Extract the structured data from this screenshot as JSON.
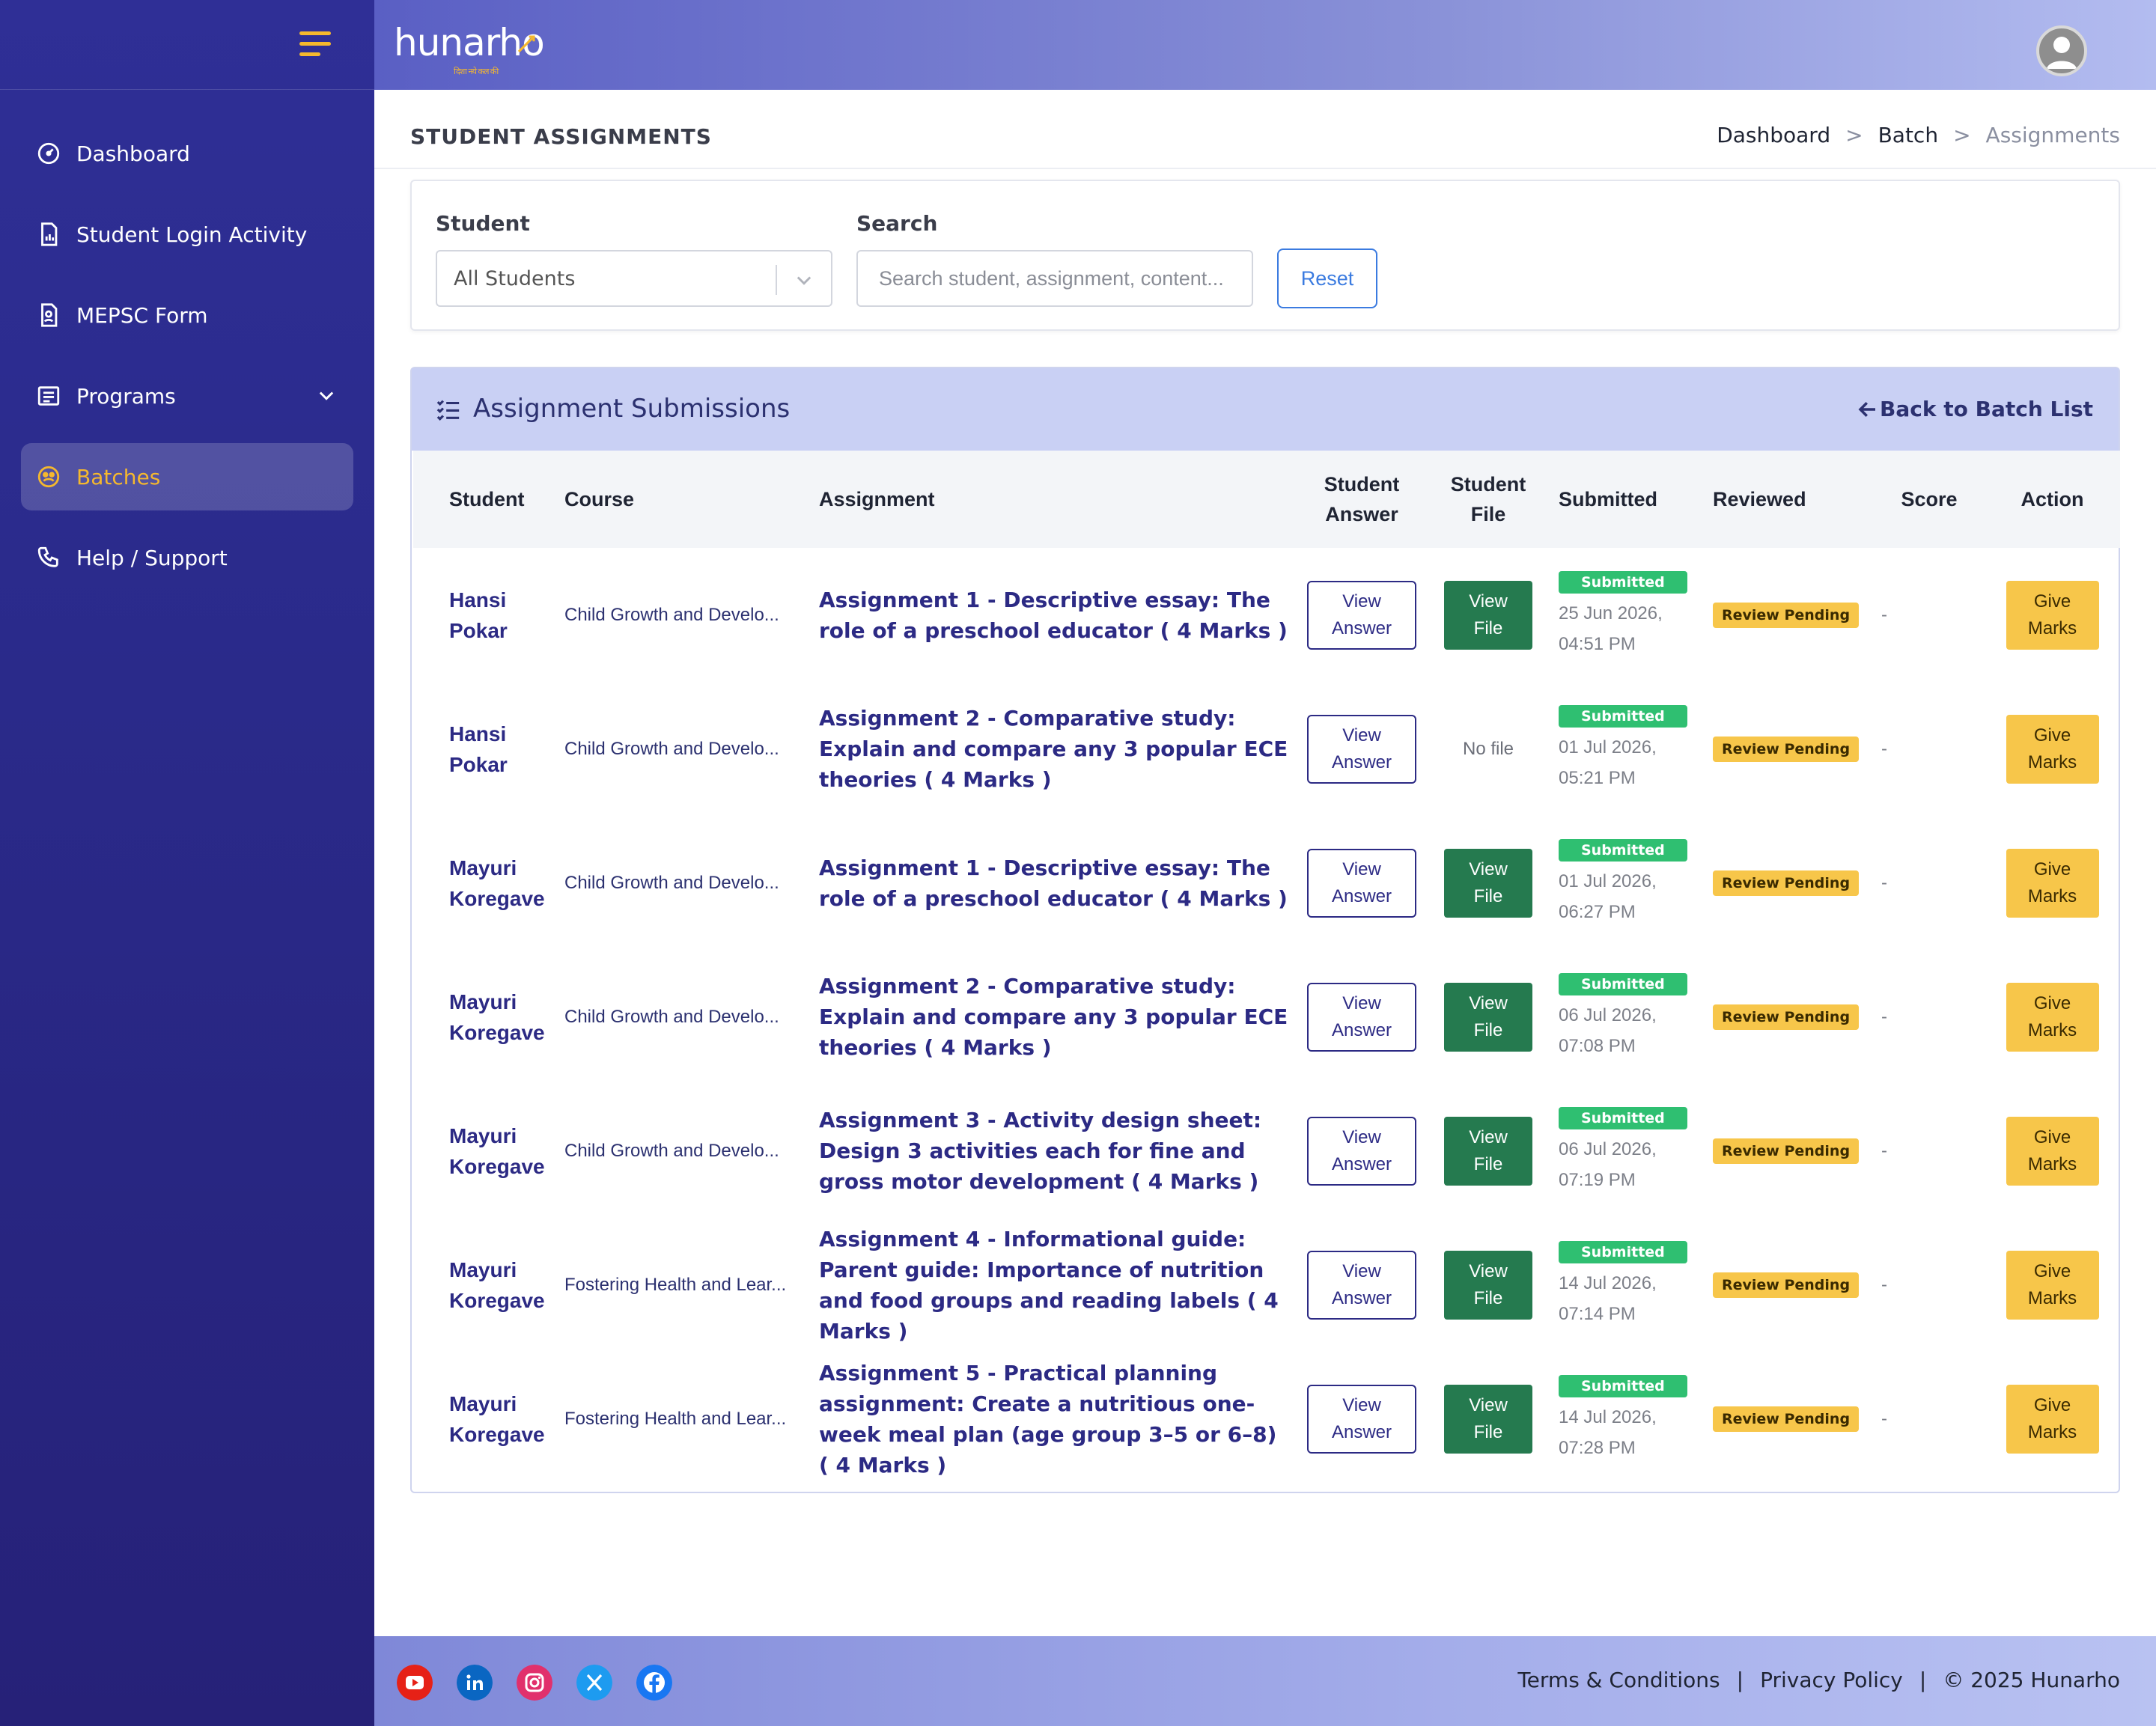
{
  "app": {
    "logo_text": "hunarho",
    "logo_tagline": "दिशा नये कल की"
  },
  "sidebar": {
    "items": [
      {
        "label": "Dashboard",
        "icon": "dashboard-gauge-icon"
      },
      {
        "label": "Student Login Activity",
        "icon": "chart-document-icon"
      },
      {
        "label": "MEPSC Form",
        "icon": "form-document-icon"
      },
      {
        "label": "Programs",
        "icon": "list-icon"
      },
      {
        "label": "Batches",
        "icon": "batches-icon",
        "active": true
      },
      {
        "label": "Help / Support",
        "icon": "phone-icon"
      }
    ]
  },
  "header": {
    "page_title": "STUDENT ASSIGNMENTS",
    "breadcrumb": {
      "item1": "Dashboard",
      "sep": ">",
      "item2": "Batch",
      "current": "Assignments"
    }
  },
  "filters": {
    "student_label": "Student",
    "student_value": "All Students",
    "search_label": "Search",
    "search_placeholder": "Search student, assignment, content...",
    "reset_label": "Reset"
  },
  "submissions": {
    "title": "Assignment Submissions",
    "back_label": "Back to Batch List",
    "columns": {
      "student": "Student",
      "course": "Course",
      "assignment": "Assignment",
      "student_answer_1": "Student",
      "student_answer_2": "Answer",
      "student_file_1": "Student",
      "student_file_2": "File",
      "submitted": "Submitted",
      "reviewed": "Reviewed",
      "score": "Score",
      "action": "Action"
    },
    "view_answer_1": "View",
    "view_answer_2": "Answer",
    "view_file_1": "View",
    "view_file_2": "File",
    "no_file": "No file",
    "submitted_badge": "Submitted",
    "review_badge": "Review Pending",
    "give_marks_1": "Give",
    "give_marks_2": "Marks",
    "rows": [
      {
        "student_first": "Hansi",
        "student_last": "Pokar",
        "course": "Child Growth and Develo...",
        "assignment": "Assignment 1 - Descriptive essay: The role of a preschool educator ( 4 Marks )",
        "has_file": true,
        "date": "25 Jun 2026,",
        "time": "04:51 PM",
        "score": "-"
      },
      {
        "student_first": "Hansi",
        "student_last": "Pokar",
        "course": "Child Growth and Develo...",
        "assignment": "Assignment 2 - Comparative study: Explain and compare any 3 popular ECE theories ( 4 Marks )",
        "has_file": false,
        "date": "01 Jul 2026,",
        "time": "05:21 PM",
        "score": "-"
      },
      {
        "student_first": "Mayuri",
        "student_last": "Koregave",
        "course": "Child Growth and Develo...",
        "assignment": "Assignment 1 - Descriptive essay: The role of a preschool educator ( 4 Marks )",
        "has_file": true,
        "date": "01 Jul 2026,",
        "time": "06:27 PM",
        "score": "-"
      },
      {
        "student_first": "Mayuri",
        "student_last": "Koregave",
        "course": "Child Growth and Develo...",
        "assignment": "Assignment 2 - Comparative study: Explain and compare any 3 popular ECE theories ( 4 Marks )",
        "has_file": true,
        "date": "06 Jul 2026,",
        "time": "07:08 PM",
        "score": "-"
      },
      {
        "student_first": "Mayuri",
        "student_last": "Koregave",
        "course": "Child Growth and Develo...",
        "assignment": "Assignment 3 - Activity design sheet: Design 3 activities each for fine and gross motor development ( 4 Marks )",
        "has_file": true,
        "date": "06 Jul 2026,",
        "time": "07:19 PM",
        "score": "-"
      },
      {
        "student_first": "Mayuri",
        "student_last": "Koregave",
        "course": "Fostering Health and Lear...",
        "assignment": "Assignment 4 - Informational guide: Parent guide: Importance of nutrition and food groups and reading labels ( 4 Marks )",
        "has_file": true,
        "date": "14 Jul 2026,",
        "time": "07:14 PM",
        "score": "-"
      },
      {
        "student_first": "Mayuri",
        "student_last": "Koregave",
        "course": "Fostering Health and Lear...",
        "assignment": "Assignment 5 - Practical planning assignment: Create a nutritious one-week meal plan (age group 3–5 or 6–8) ( 4 Marks )",
        "has_file": true,
        "date": "14 Jul 2026,",
        "time": "07:28 PM",
        "score": "-"
      }
    ]
  },
  "footer": {
    "social": [
      "youtube-icon",
      "linkedin-icon",
      "instagram-icon",
      "x-twitter-icon",
      "facebook-icon"
    ],
    "terms": "Terms & Conditions",
    "sep": "|",
    "privacy": "Privacy Policy",
    "copyright": "© 2025 Hunarho"
  },
  "colors": {
    "sidebar_bg": "#2f2f96",
    "accent_yellow": "#f5b82e",
    "header_light": "#c9d0f4",
    "green_button": "#257a4f",
    "submitted_green": "#2fbf71",
    "link_blue": "#3b7be0"
  }
}
